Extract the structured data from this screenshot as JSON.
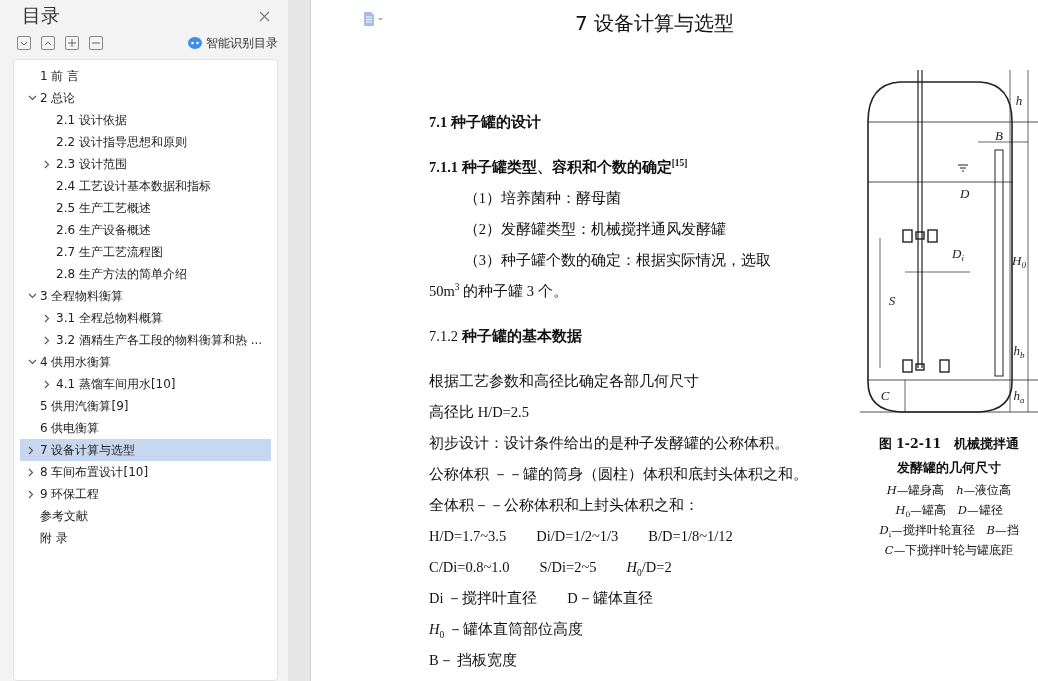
{
  "sidebar": {
    "title": "目录",
    "smart_label": "智能识别目录",
    "items": [
      {
        "label": "1 前  言",
        "selected": false
      },
      {
        "label": "2 总论",
        "selected": false,
        "expanded": true,
        "children": [
          {
            "label": "2.1 设计依据",
            "selected": false
          },
          {
            "label": "2.2 设计指导思想和原则",
            "selected": false
          },
          {
            "label": "2.3 设计范围",
            "selected": false,
            "expanded": false
          },
          {
            "label": "2.4 工艺设计基本数据和指标",
            "selected": false
          },
          {
            "label": "2.5 生产工艺概述",
            "selected": false
          },
          {
            "label": "2.6 生产设备概述",
            "selected": false
          },
          {
            "label": "2.7 生产工艺流程图",
            "selected": false
          },
          {
            "label": "2.8 生产方法的简单介绍",
            "selected": false
          }
        ]
      },
      {
        "label": "3 全程物料衡算",
        "selected": false,
        "expanded": true,
        "children": [
          {
            "label": "3.1 全程总物料概算",
            "selected": false,
            "expanded": false
          },
          {
            "label": "3.2 酒精生产各工段的物料衡算和热 ...",
            "selected": false,
            "expanded": false
          }
        ]
      },
      {
        "label": "4  供用水衡算",
        "selected": false,
        "expanded": true,
        "children": [
          {
            "label": "4.1 蒸馏车间用水[10]",
            "selected": false,
            "expanded": false
          }
        ]
      },
      {
        "label": "5 供用汽衡算[9]",
        "selected": false
      },
      {
        "label": "6 供电衡算",
        "selected": false
      },
      {
        "label": "7 设备计算与选型",
        "selected": true,
        "expanded": false
      },
      {
        "label": "8 车间布置设计[10]",
        "selected": false,
        "expanded": false
      },
      {
        "label": "9 环保工程",
        "selected": false,
        "expanded": false
      },
      {
        "label": "参考文献",
        "selected": false
      },
      {
        "label": "附  录",
        "selected": false
      }
    ]
  },
  "document": {
    "title": "7 设备计算与选型",
    "blocks": [
      {
        "kind": "h2",
        "text": "7.1 种子罐的设计"
      },
      {
        "kind": "h3",
        "text": "7.1.1 种子罐类型、容积和个数的确定$^{[15]}$"
      },
      {
        "kind": "para",
        "text": "（1）培养菌种：酵母菌"
      },
      {
        "kind": "para",
        "text": "（2）发酵罐类型：机械搅拌通风发酵罐"
      },
      {
        "kind": "para",
        "text": "（3）种子罐个数的确定：根据实际情况，选取50m$^{3}$ 的种子罐 3 个。"
      },
      {
        "kind": "h3plain",
        "text": "7.1.2 **种子罐的基本数据**"
      },
      {
        "kind": "line",
        "text": "根据工艺参数和高径比确定各部几何尺寸"
      },
      {
        "kind": "line",
        "text": " 高径比 H/D=2.5"
      },
      {
        "kind": "line",
        "text": " 初步设计：设计条件给出的是种子发酵罐的公称体积。"
      },
      {
        "kind": "line",
        "text": " 公称体积 －－罐的筒身（圆柱）体积和底封头体积之和。"
      },
      {
        "kind": "line",
        "text": "全体积－－公称体积和上封头体积之和："
      },
      {
        "kind": "cols",
        "items": [
          "H/D=1.7~3.5",
          "Di/D=1/2~1/3",
          "B/D=1/8~1/12"
        ]
      },
      {
        "kind": "cols",
        "items": [
          "C/Di=0.8~1.0",
          "S/Di=2~5",
          "*H*$_{0}$/D=2"
        ]
      },
      {
        "kind": "cols",
        "items": [
          "Di －搅拌叶直径",
          "D－罐体直径"
        ]
      },
      {
        "kind": "line",
        "text": "*H*$_{0}$ －罐体直筒部位高度"
      },
      {
        "kind": "line",
        "text": "B－  挡板宽度"
      }
    ],
    "figure": {
      "labels": [
        {
          "text": "h"
        },
        {
          "text": "B"
        },
        {
          "text": "D"
        },
        {
          "text": "D",
          "sub": "i"
        },
        {
          "text": "H",
          "sub": "0"
        },
        {
          "text": "S"
        },
        {
          "text": "h",
          "sub": "b"
        },
        {
          "text": "C"
        },
        {
          "text": "h",
          "sub": "a"
        }
      ],
      "caption": [
        "图 1-2-11　机械搅拌通",
        "发酵罐的几何尺寸",
        "*H*—罐身高　*h*—液位高",
        "*H*$_{0}$—罐高　*D*—罐径",
        "*D*$_{i}$—搅拌叶轮直径　*B*—挡",
        "*C*—下搅拌叶轮与罐底距"
      ]
    }
  }
}
